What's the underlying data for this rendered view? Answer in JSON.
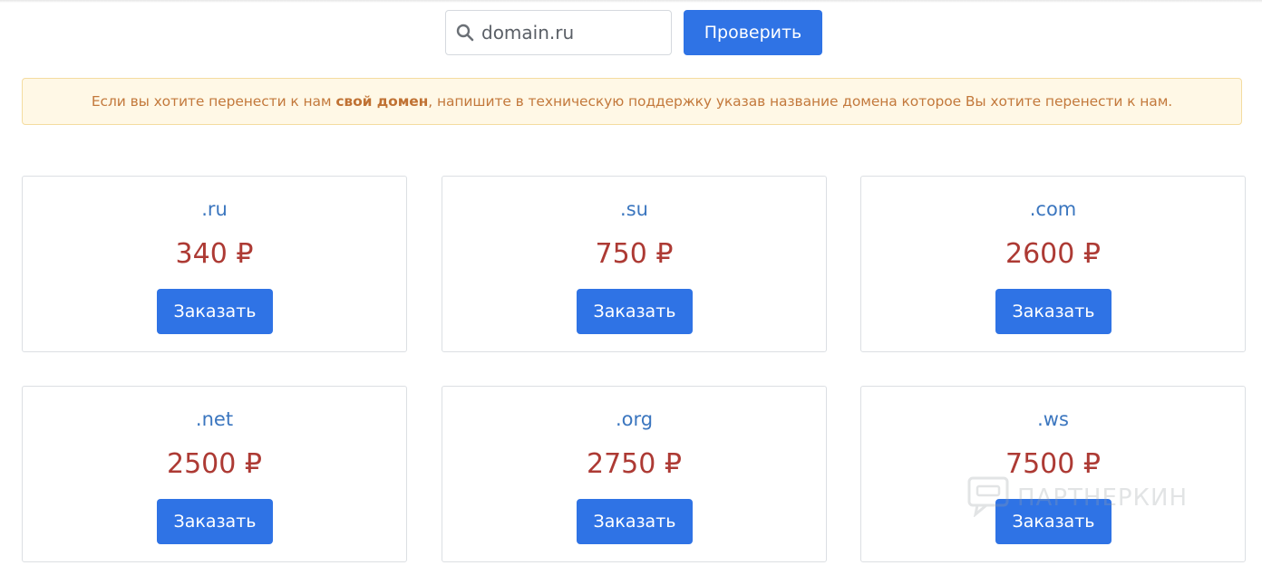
{
  "search": {
    "value": "domain.ru",
    "icon": "search-icon",
    "button_label": "Проверить"
  },
  "alert": {
    "text_before": "Если вы хотите перенести к нам ",
    "text_bold": "свой домен",
    "text_after": ", напишите в техническую поддержку указав название домена которое Вы хотите перенести к нам."
  },
  "zones": [
    {
      "name": ".ru",
      "price": "340 ₽",
      "button_label": "Заказать"
    },
    {
      "name": ".su",
      "price": "750 ₽",
      "button_label": "Заказать"
    },
    {
      "name": ".com",
      "price": "2600 ₽",
      "button_label": "Заказать"
    },
    {
      "name": ".net",
      "price": "2500 ₽",
      "button_label": "Заказать"
    },
    {
      "name": ".org",
      "price": "2750 ₽",
      "button_label": "Заказать"
    },
    {
      "name": ".ws",
      "price": "7500 ₽",
      "button_label": "Заказать"
    }
  ],
  "watermark": {
    "text": "ПАРТНЕРКИН"
  },
  "colors": {
    "primary": "#2f73e5",
    "zone_name": "#3b76bf",
    "price": "#ad3a34",
    "alert_text": "#c3793c",
    "alert_bg": "#fff8e6"
  }
}
